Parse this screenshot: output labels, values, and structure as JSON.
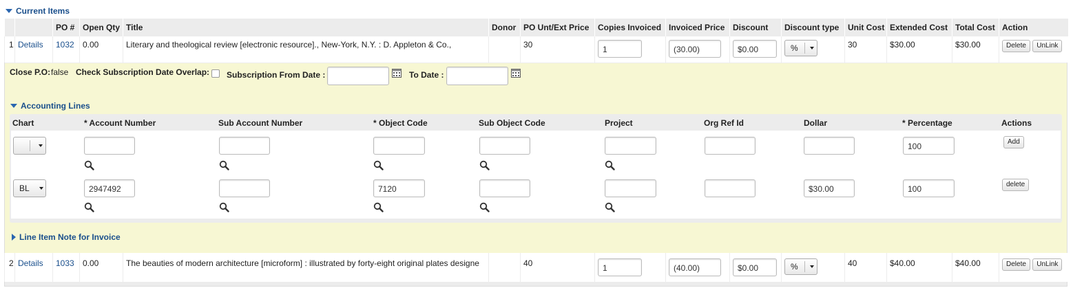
{
  "current_items": {
    "title": "Current Items",
    "columns": [
      "",
      "",
      "PO #",
      "Open Qty",
      "Title",
      "Donor",
      "PO Unt/Ext Price",
      "Copies Invoiced",
      "Invoiced Price",
      "Discount",
      "Discount type",
      "Unit Cost",
      "Extended Cost",
      "Total Cost",
      "Action"
    ],
    "rows": [
      {
        "num": "1",
        "details": "Details",
        "po": "1032",
        "open_qty": "0.00",
        "title": "Literary and theological review [electronic resource]., New-York, N.Y. : D. Appleton & Co.,",
        "donor": "",
        "po_price": "30",
        "copies": "1",
        "invoiced_price": "(30.00)",
        "discount": "$0.00",
        "discount_type": "%",
        "unit_cost": "30",
        "extended_cost": "$30.00",
        "total_cost": "$30.00",
        "delete": "Delete",
        "unlink": "UnLink"
      },
      {
        "num": "2",
        "details": "Details",
        "po": "1033",
        "open_qty": "0.00",
        "title": "The beauties of modern architecture [microform] : illustrated by forty-eight original plates designe",
        "donor": "",
        "po_price": "40",
        "copies": "1",
        "invoiced_price": "(40.00)",
        "discount": "$0.00",
        "discount_type": "%",
        "unit_cost": "40",
        "extended_cost": "$40.00",
        "total_cost": "$40.00",
        "delete": "Delete",
        "unlink": "UnLink"
      }
    ]
  },
  "po_options": {
    "close_po_label": "Close P.O:",
    "close_po_value": "false",
    "check_overlap_label": "Check Subscription Date Overlap:",
    "sub_from_label": "Subscription From Date :",
    "to_date_label": "To Date :"
  },
  "accounting": {
    "title": "Accounting Lines",
    "columns": [
      "Chart",
      "* Account Number",
      "Sub Account Number",
      "* Object Code",
      "Sub Object Code",
      "Project",
      "Org Ref Id",
      "Dollar",
      "* Percentage",
      "Actions"
    ],
    "new_line": {
      "chart": "",
      "account": "",
      "sub_account": "",
      "object_code": "",
      "sub_object": "",
      "project": "",
      "org_ref": "",
      "dollar": "",
      "percentage": "100",
      "action": "Add"
    },
    "lines": [
      {
        "chart": "BL",
        "account": "2947492",
        "sub_account": "",
        "object_code": "7120",
        "sub_object": "",
        "project": "",
        "org_ref": "",
        "dollar": "$30.00",
        "percentage": "100",
        "action": "delete"
      }
    ]
  },
  "line_item_note": {
    "title": "Line Item Note for Invoice"
  },
  "icons": [
    "triangle-down-icon",
    "triangle-right-icon",
    "calendar-icon",
    "magnifier-icon",
    "dropdown-caret-icon"
  ],
  "colors": {
    "link": "#1a4f8c",
    "highlight": "#f7f7d3",
    "header_bg": "#ececec"
  }
}
